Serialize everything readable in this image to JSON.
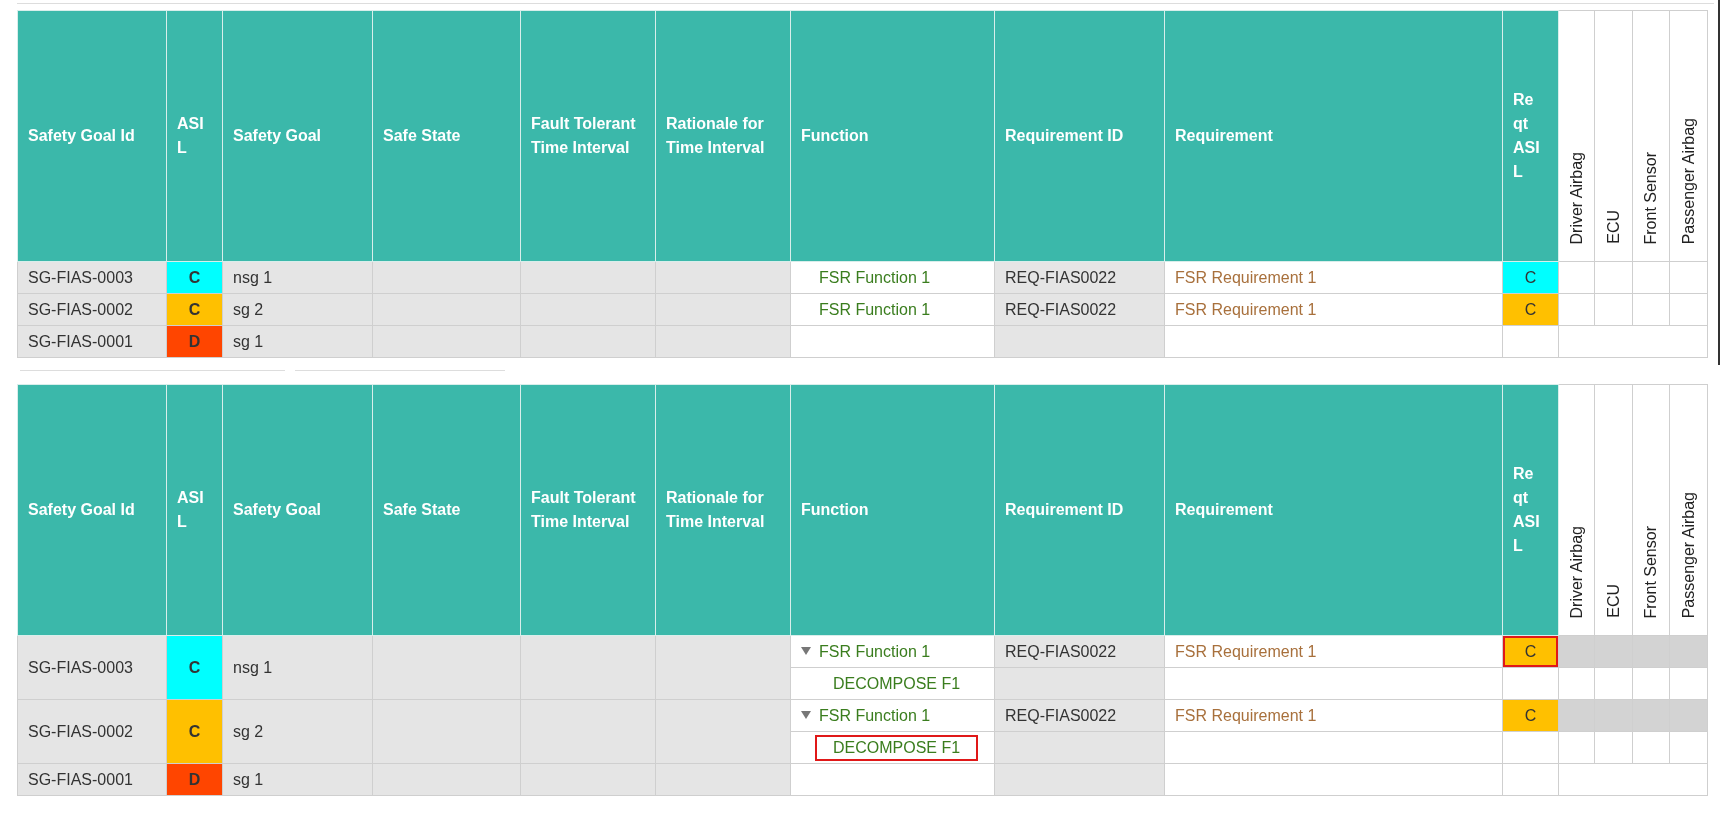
{
  "tables": [
    {
      "columns": [
        {
          "label": "Safety Goal Id",
          "kind": "text"
        },
        {
          "label": "ASIL",
          "kind": "narrow"
        },
        {
          "label": "Safety Goal",
          "kind": "text"
        },
        {
          "label": "Safe State",
          "kind": "text"
        },
        {
          "label": "Fault Tolerant Time Interval",
          "kind": "text"
        },
        {
          "label": "Rationale for Time Interval",
          "kind": "text"
        },
        {
          "label": "Function",
          "kind": "text"
        },
        {
          "label": "Requirement ID",
          "kind": "text"
        },
        {
          "label": "Requirement",
          "kind": "text"
        },
        {
          "label": "Reqt ASIL",
          "kind": "narrow"
        },
        {
          "label": "Driver Airbag",
          "kind": "vertical"
        },
        {
          "label": "ECU",
          "kind": "vertical"
        },
        {
          "label": "Front Sensor",
          "kind": "vertical"
        },
        {
          "label": "Passenger Airbag",
          "kind": "vertical"
        }
      ],
      "rows": [
        {
          "goal_id": "SG-FIAS-0003",
          "asil": {
            "label": "C",
            "color": "#00ffff"
          },
          "safety_goal": "nsg 1",
          "functions": [
            {
              "name": "FSR Function 1",
              "requirement_id": "REQ-FIAS0022",
              "requirement": "FSR Requirement 1",
              "reqt_asil": {
                "label": "C",
                "color": "#00ffff",
                "highlighted": false
              },
              "shaded": false
            }
          ]
        },
        {
          "goal_id": "SG-FIAS-0002",
          "asil": {
            "label": "C",
            "color": "#ffc000"
          },
          "safety_goal": "sg 2",
          "functions": [
            {
              "name": "FSR Function 1",
              "requirement_id": "REQ-FIAS0022",
              "requirement": "FSR Requirement 1",
              "reqt_asil": {
                "label": "C",
                "color": "#ffc000",
                "highlighted": false
              },
              "shaded": false
            }
          ]
        },
        {
          "goal_id": "SG-FIAS-0001",
          "asil": {
            "label": "D",
            "color": "#ff4500"
          },
          "safety_goal": "sg 1"
        }
      ]
    },
    {
      "columns": [
        {
          "label": "Safety Goal Id",
          "kind": "text"
        },
        {
          "label": "ASIL",
          "kind": "narrow"
        },
        {
          "label": "Safety Goal",
          "kind": "text"
        },
        {
          "label": "Safe State",
          "kind": "text"
        },
        {
          "label": "Fault Tolerant Time Interval",
          "kind": "text"
        },
        {
          "label": "Rationale for Time Interval",
          "kind": "text"
        },
        {
          "label": "Function",
          "kind": "text"
        },
        {
          "label": "Requirement ID",
          "kind": "text"
        },
        {
          "label": "Requirement",
          "kind": "text"
        },
        {
          "label": "Reqt ASIL",
          "kind": "narrow"
        },
        {
          "label": "Driver Airbag",
          "kind": "vertical"
        },
        {
          "label": "ECU",
          "kind": "vertical"
        },
        {
          "label": "Front Sensor",
          "kind": "vertical"
        },
        {
          "label": "Passenger Airbag",
          "kind": "vertical"
        }
      ],
      "rows": [
        {
          "goal_id": "SG-FIAS-0003",
          "asil": {
            "label": "C",
            "color": "#00ffff"
          },
          "safety_goal": "nsg 1",
          "functions": [
            {
              "name": "FSR Function 1",
              "expanded": true,
              "requirement_id": "REQ-FIAS0022",
              "requirement": "FSR Requirement 1",
              "reqt_asil": {
                "label": "C",
                "color": "#ffc000",
                "highlighted": true
              },
              "shaded": true,
              "children": [
                {
                  "name": "DECOMPOSE F1",
                  "highlighted": false
                }
              ]
            }
          ]
        },
        {
          "goal_id": "SG-FIAS-0002",
          "asil": {
            "label": "C",
            "color": "#ffc000"
          },
          "safety_goal": "sg 2",
          "functions": [
            {
              "name": "FSR Function 1",
              "expanded": true,
              "requirement_id": "REQ-FIAS0022",
              "requirement": "FSR Requirement 1",
              "reqt_asil": {
                "label": "C",
                "color": "#ffc000",
                "highlighted": false
              },
              "shaded": true,
              "children": [
                {
                  "name": "DECOMPOSE F1",
                  "highlighted": true
                }
              ]
            }
          ]
        },
        {
          "goal_id": "SG-FIAS-0001",
          "asil": {
            "label": "D",
            "color": "#ff4500"
          },
          "safety_goal": "sg 1"
        }
      ]
    }
  ]
}
